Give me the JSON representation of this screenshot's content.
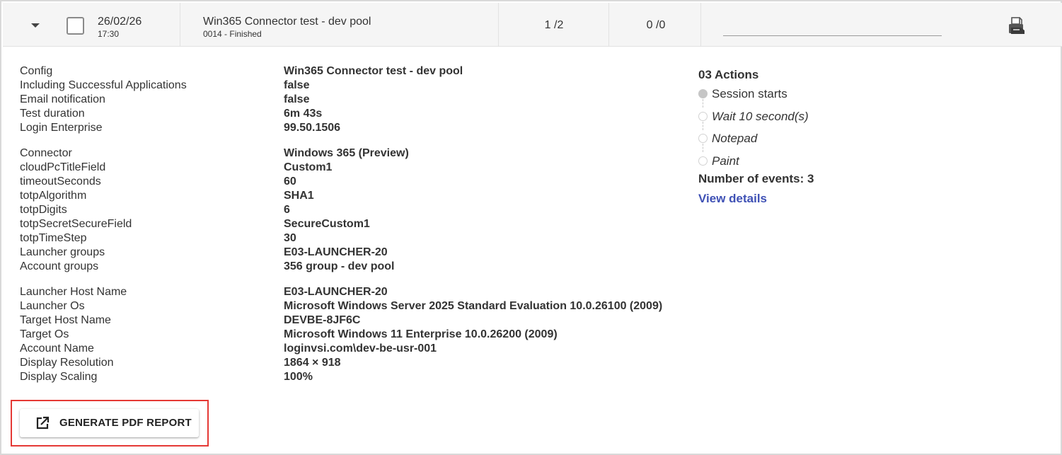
{
  "row": {
    "date": "26/02/26",
    "time": "17:30",
    "title": "Win365 Connector test - dev pool",
    "subtitle": "0014 - Finished",
    "count_a": "1 /2",
    "count_b": "0 /0",
    "icons": {
      "expand": "chevron-down-icon",
      "pdf": "printer-export-icon"
    }
  },
  "details": {
    "group1": [
      {
        "label": "Config",
        "value": "Win365 Connector test - dev pool"
      },
      {
        "label": "Including Successful Applications",
        "value": "false"
      },
      {
        "label": "Email notification",
        "value": "false"
      },
      {
        "label": "Test duration",
        "value": "6m 43s"
      },
      {
        "label": "Login Enterprise",
        "value": "99.50.1506"
      }
    ],
    "group2": [
      {
        "label": "Connector",
        "value": "Windows 365 (Preview)"
      },
      {
        "label": "cloudPcTitleField",
        "value": "Custom1"
      },
      {
        "label": "timeoutSeconds",
        "value": "60"
      },
      {
        "label": "totpAlgorithm",
        "value": "SHA1"
      },
      {
        "label": "totpDigits",
        "value": "6"
      },
      {
        "label": "totpSecretSecureField",
        "value": "SecureCustom1"
      },
      {
        "label": "totpTimeStep",
        "value": "30"
      },
      {
        "label": "Launcher groups",
        "value": "E03-LAUNCHER-20"
      },
      {
        "label": "Account groups",
        "value": "356 group - dev pool"
      }
    ],
    "group3": [
      {
        "label": "Launcher Host Name",
        "value": "E03-LAUNCHER-20"
      },
      {
        "label": "Launcher Os",
        "value": "Microsoft Windows Server 2025 Standard Evaluation 10.0.26100 (2009)"
      },
      {
        "label": "Target Host Name",
        "value": "DEVBE-8JF6C"
      },
      {
        "label": "Target Os",
        "value": "Microsoft Windows 11 Enterprise 10.0.26200 (2009)"
      },
      {
        "label": "Account Name",
        "value": "loginvsi.com\\dev-be-usr-001"
      },
      {
        "label": "Display Resolution",
        "value": "1864 × 918"
      },
      {
        "label": "Display Scaling",
        "value": "100%"
      }
    ]
  },
  "actions": {
    "title": "03 Actions",
    "items": [
      {
        "label": "Session starts",
        "italic": false,
        "filled": true
      },
      {
        "label": "Wait 10 second(s)",
        "italic": true,
        "filled": false
      },
      {
        "label": "Notepad",
        "italic": true,
        "filled": false
      },
      {
        "label": "Paint",
        "italic": true,
        "filled": false
      }
    ],
    "events_label": "Number of events: 3",
    "view_details": "View details"
  },
  "report_button": {
    "label": "GENERATE PDF REPORT",
    "icon": "open-external-icon"
  },
  "colors": {
    "accent": "#3f51b5",
    "highlight": "#e53935",
    "header_bg": "#f5f5f5"
  }
}
